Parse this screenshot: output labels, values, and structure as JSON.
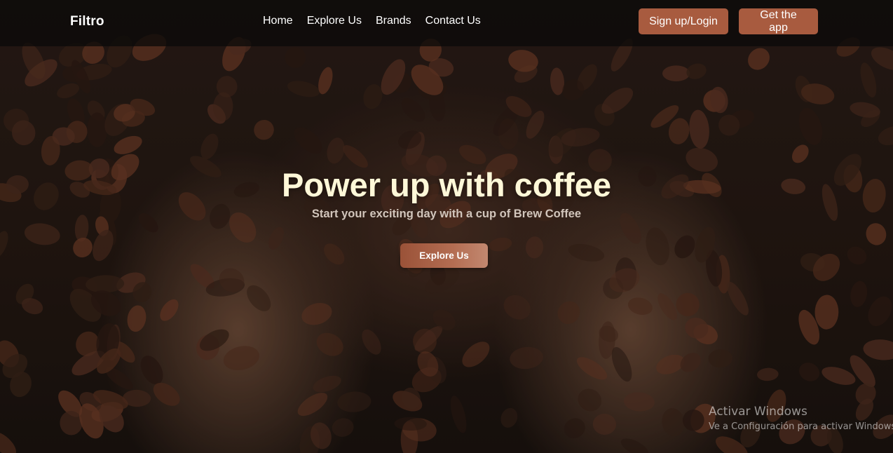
{
  "navbar": {
    "brand": "Filtro",
    "links": [
      {
        "label": "Home"
      },
      {
        "label": "Explore Us"
      },
      {
        "label": "Brands"
      },
      {
        "label": "Contact Us"
      }
    ],
    "signup_label": "Sign up/Login",
    "app_label": "Get the app"
  },
  "hero": {
    "title": "Power up with coffee",
    "subtitle": "Start your exciting day with a cup of Brew Coffee",
    "cta_label": "Explore Us",
    "background_image": "hands-holding-coffee-beans"
  },
  "watermark": {
    "title": "Activar Windows",
    "subtitle": "Ve a Configuración para activar Windows."
  },
  "colors": {
    "accent": "#a85b3f",
    "title": "#fff8d8",
    "navbar_bg": "#0c0a09"
  }
}
